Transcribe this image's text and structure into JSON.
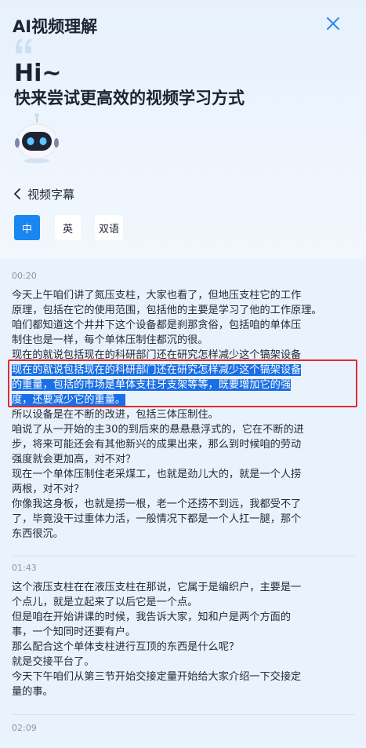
{
  "header": {
    "brand": "AI视频理解",
    "greeting": "Hi~",
    "slogan": "快来尝试更高效的视频学习方式"
  },
  "nav": {
    "back_label": "视频字幕"
  },
  "language_tabs": [
    {
      "label": "中",
      "active": true
    },
    {
      "label": "英",
      "active": false
    },
    {
      "label": "双语",
      "active": false
    }
  ],
  "subtitles": {
    "segment_1": {
      "time": "00:20",
      "lines": [
        "今天上午咱们讲了氮压支柱，大家也看了，但地压支柱它的工作",
        "原理，包括在它的使用范围，包括他的主要是学习了他的工作原理。",
        "咱们都知道这个井井下这个设备都是刹那贪俗，包括咱的单体压",
        "制住也是一样，每个单体压制住都沉的很。",
        "现在的就说包括现在的科研部门还在研究怎样减少这个镐架设备",
        "的重量，包括的市场是单体支柱牙支架等等，既要增加它的强",
        "度，还要减少它的重量。",
        "所以设备是在不断的改进，包括三体压制住。",
        "咱说了从一开始的主30的到后来的悬悬悬浮式的，它在不断的进",
        "步，将来可能还会有其他新兴的成果出来，那么到时候咱的劳动",
        "强度就会更加高，对不对？",
        "现在一个单体压制住老采煤工，也就是劲儿大的，就是一个人捞",
        "两根，对不对？",
        "你像我这身板，也就是捞一根，老一个还捞不到远，我都受不了",
        "了，毕竟没干过重体力活，一般情况下都是一个人扛一腿，那个",
        "东西很沉。"
      ]
    },
    "segment_2": {
      "time": "01:43",
      "lines": [
        "这个液压支柱在在液压支柱在那说，它属于是编织户，主要是一",
        "个点儿，就是立起来了以后它是一个点。",
        "但是咱在开始讲课的时候，我告诉大家，知和户是两个方面的",
        "事，一个知同时还要有户。",
        "那么配合这个单体支柱进行互顶的东西是什么呢？",
        "就是交接平台了。",
        "今天下午咱们从第三节开始交接定量开始给大家介绍一下交接定",
        "量的事。"
      ]
    },
    "segment_3": {
      "time": "02:09"
    }
  },
  "colors": {
    "accent": "#1a86f2",
    "highlight": "#1b6fe6",
    "annotation_box": "#e02c2c"
  }
}
